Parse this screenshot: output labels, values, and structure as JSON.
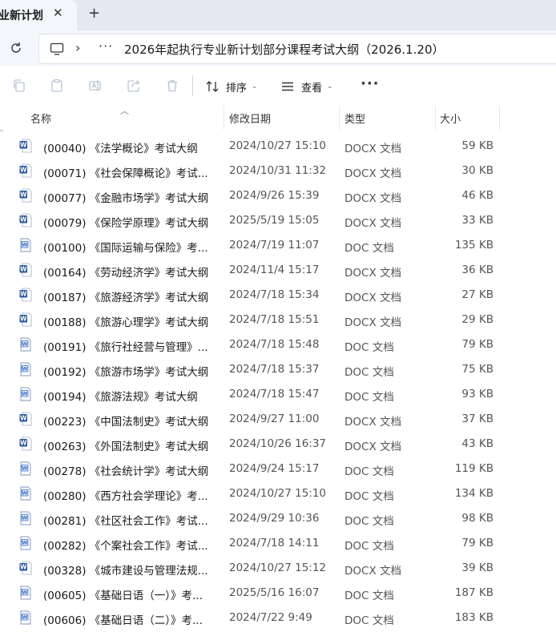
{
  "tab": {
    "title": "业新计划",
    "close_glyph": "✕",
    "add_glyph": "+"
  },
  "address": {
    "more_glyph": "···",
    "chevron_glyph": "›",
    "path": "2026年起执行专业新计划部分课程考试大纲（2026.1.20）"
  },
  "toolbar": {
    "sort_label": "排序",
    "view_label": "查看",
    "more_glyph": "···"
  },
  "columns": {
    "name": "名称",
    "date": "修改日期",
    "type": "类型",
    "size": "大小"
  },
  "files": [
    {
      "name": "(00040) 《法学概论》考试大纲",
      "date": "2024/10/27 15:10",
      "type": "DOCX 文档",
      "size": "59 KB",
      "kind": "docx"
    },
    {
      "name": "(00071) 《社会保障概论》考试...",
      "date": "2024/10/31 11:32",
      "type": "DOCX 文档",
      "size": "30 KB",
      "kind": "docx"
    },
    {
      "name": "(00077) 《金融市场学》考试大纲",
      "date": "2024/9/26 15:39",
      "type": "DOCX 文档",
      "size": "46 KB",
      "kind": "docx"
    },
    {
      "name": "(00079) 《保险学原理》考试大纲",
      "date": "2025/5/19 15:05",
      "type": "DOCX 文档",
      "size": "33 KB",
      "kind": "docx"
    },
    {
      "name": "(00100) 《国际运输与保险》考...",
      "date": "2024/7/19 11:07",
      "type": "DOC 文档",
      "size": "135 KB",
      "kind": "doc"
    },
    {
      "name": "(00164) 《劳动经济学》考试大纲",
      "date": "2024/11/4 15:17",
      "type": "DOCX 文档",
      "size": "36 KB",
      "kind": "docx"
    },
    {
      "name": "(00187) 《旅游经济学》考试大纲",
      "date": "2024/7/18 15:34",
      "type": "DOCX 文档",
      "size": "27 KB",
      "kind": "docx"
    },
    {
      "name": "(00188) 《旅游心理学》考试大纲",
      "date": "2024/7/18 15:51",
      "type": "DOCX 文档",
      "size": "29 KB",
      "kind": "docx"
    },
    {
      "name": "(00191) 《旅行社经营与管理》...",
      "date": "2024/7/18 15:48",
      "type": "DOC 文档",
      "size": "79 KB",
      "kind": "doc"
    },
    {
      "name": "(00192) 《旅游市场学》考试大纲",
      "date": "2024/7/18 15:37",
      "type": "DOC 文档",
      "size": "75 KB",
      "kind": "doc"
    },
    {
      "name": "(00194) 《旅游法规》考试大纲",
      "date": "2024/7/18 15:47",
      "type": "DOC 文档",
      "size": "93 KB",
      "kind": "doc"
    },
    {
      "name": "(00223) 《中国法制史》考试大纲",
      "date": "2024/9/27 11:00",
      "type": "DOCX 文档",
      "size": "37 KB",
      "kind": "docx"
    },
    {
      "name": "(00263) 《外国法制史》考试大纲",
      "date": "2024/10/26 16:37",
      "type": "DOCX 文档",
      "size": "43 KB",
      "kind": "docx"
    },
    {
      "name": "(00278) 《社会统计学》考试大纲",
      "date": "2024/9/24 15:17",
      "type": "DOC 文档",
      "size": "119 KB",
      "kind": "doc"
    },
    {
      "name": "(00280) 《西方社会学理论》考...",
      "date": "2024/10/27 15:10",
      "type": "DOC 文档",
      "size": "134 KB",
      "kind": "doc"
    },
    {
      "name": "(00281) 《社区社会工作》考试...",
      "date": "2024/9/29 10:36",
      "type": "DOC 文档",
      "size": "98 KB",
      "kind": "doc"
    },
    {
      "name": "(00282) 《个案社会工作》考试...",
      "date": "2024/7/18 14:11",
      "type": "DOC 文档",
      "size": "79 KB",
      "kind": "doc"
    },
    {
      "name": "(00328) 《城市建设与管理法规...",
      "date": "2024/10/27 15:12",
      "type": "DOCX 文档",
      "size": "39 KB",
      "kind": "docx"
    },
    {
      "name": "(00605) 《基础日语（一）》考...",
      "date": "2025/5/16 16:07",
      "type": "DOC 文档",
      "size": "187 KB",
      "kind": "doc"
    },
    {
      "name": "(00606) 《基础日语（二）》考...",
      "date": "2024/7/22 9:49",
      "type": "DOC 文档",
      "size": "183 KB",
      "kind": "doc"
    }
  ],
  "colors": {
    "docx_icon": "#2b579a",
    "doc_icon": "#3a6fc4",
    "chrome_bg": "#e4e9f1",
    "addr_bg": "#f3f6fb"
  }
}
